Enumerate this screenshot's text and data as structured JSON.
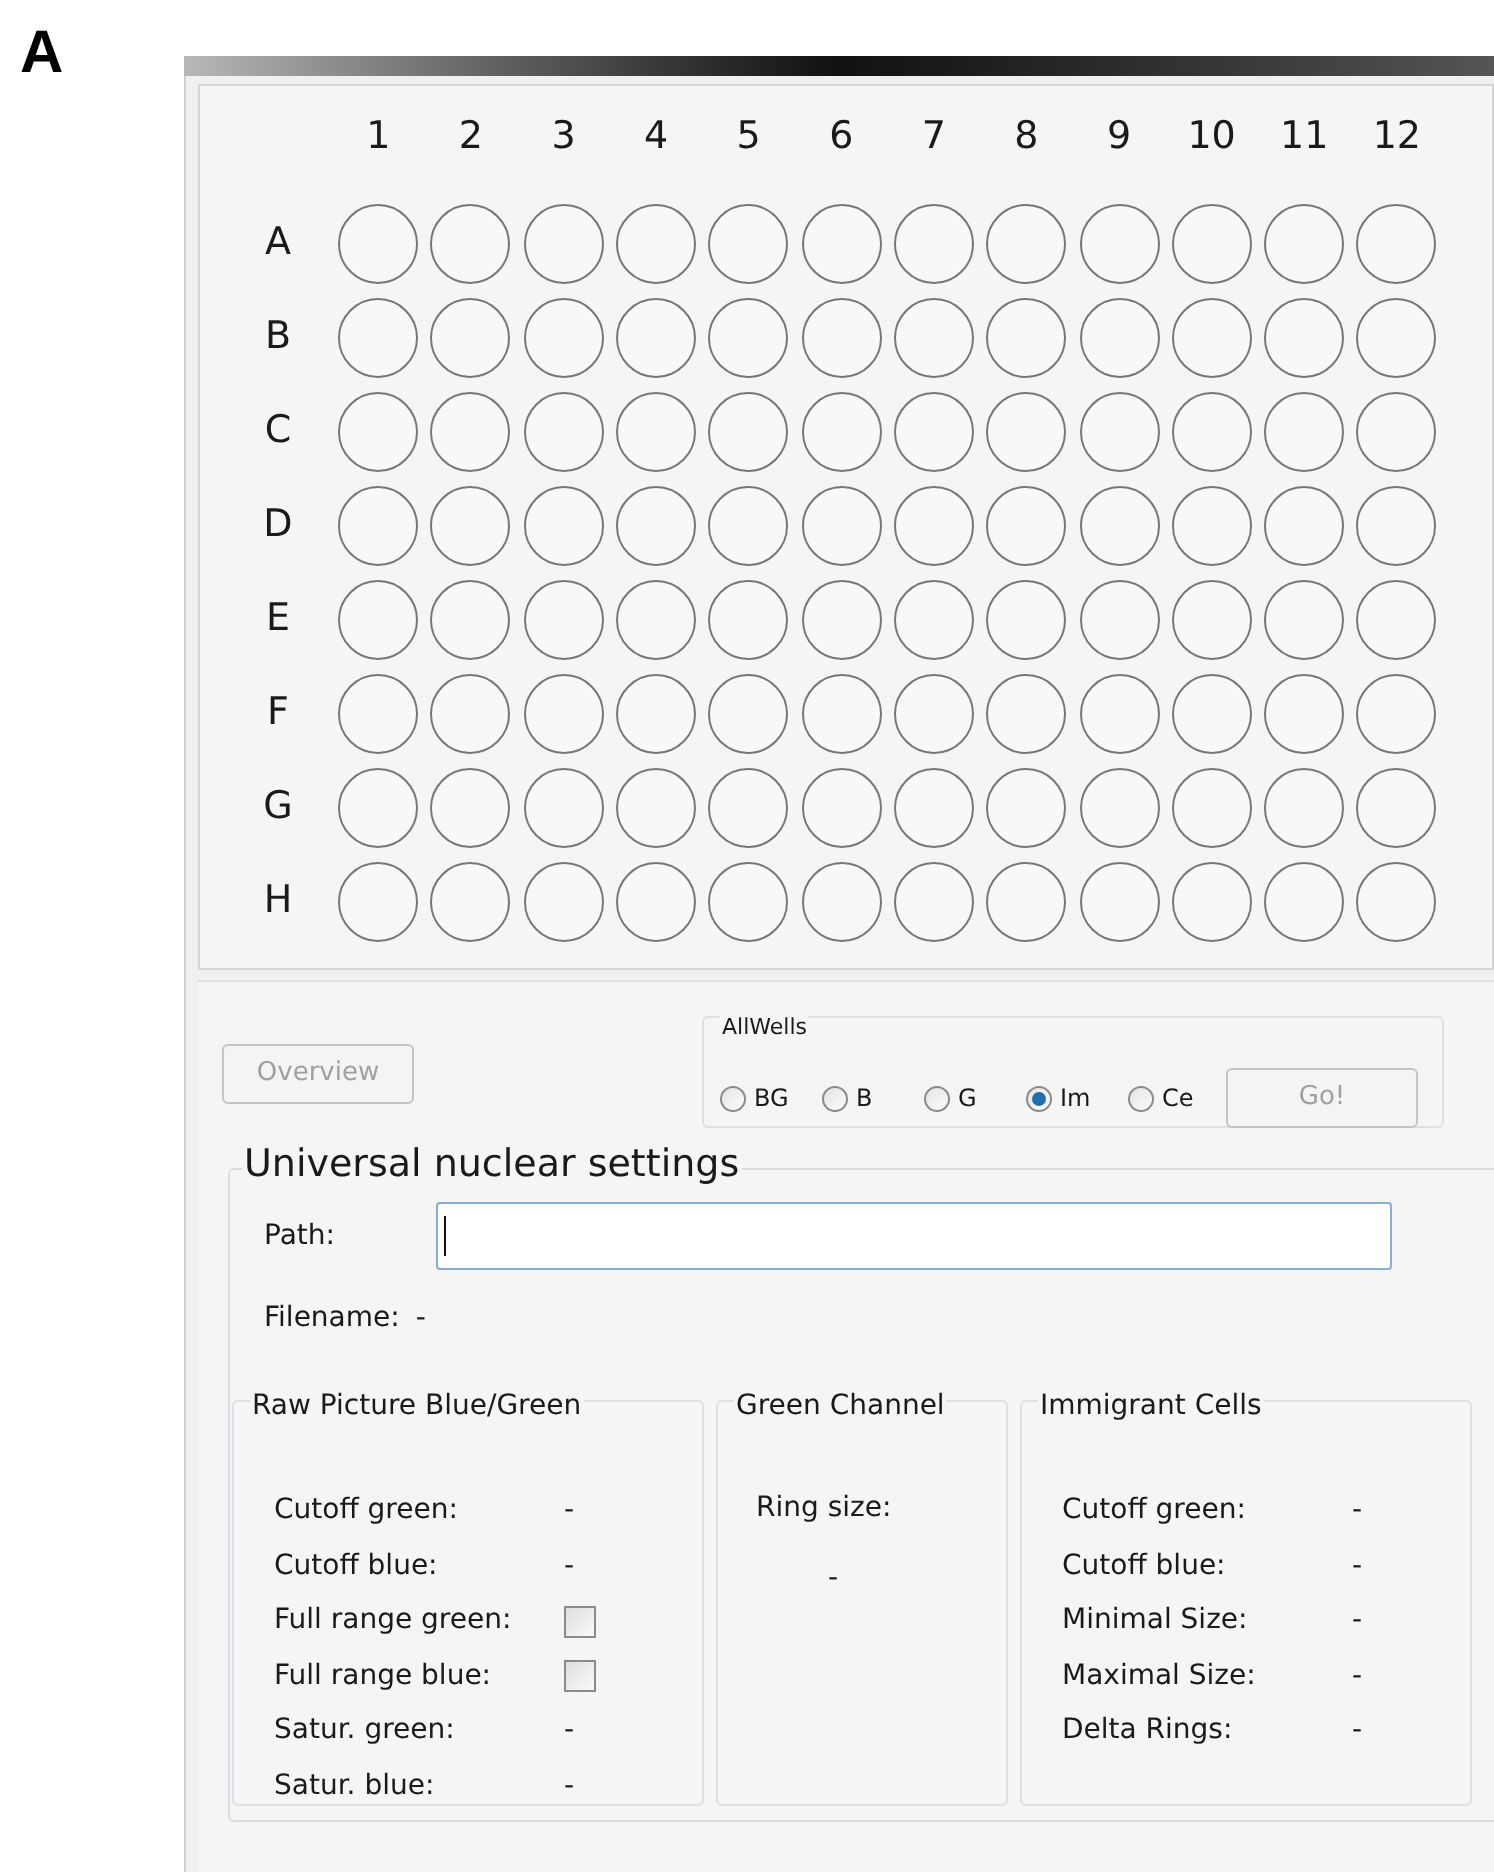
{
  "panel_label": "A",
  "plate": {
    "columns": [
      "1",
      "2",
      "3",
      "4",
      "5",
      "6",
      "7",
      "8",
      "9",
      "10",
      "11",
      "12"
    ],
    "rows": [
      "A",
      "B",
      "C",
      "D",
      "E",
      "F",
      "G",
      "H"
    ]
  },
  "overview_button": {
    "label": "Overview",
    "disabled": true
  },
  "all_wells": {
    "title": "AllWells",
    "options": [
      {
        "label": "BG",
        "selected": false
      },
      {
        "label": "B",
        "selected": false
      },
      {
        "label": "G",
        "selected": false
      },
      {
        "label": "Im",
        "selected": true
      },
      {
        "label": "Ce",
        "selected": false
      }
    ],
    "go_button": {
      "label": "Go!",
      "disabled": true
    }
  },
  "settings": {
    "title": "Universal nuclear settings",
    "path_label": "Path:",
    "filename_label": "Filename:",
    "filename_value": "-",
    "groups": [
      {
        "title": "Raw Picture Blue/Green",
        "items": [
          {
            "kind": "value",
            "label": "Cutoff green:",
            "value": "-"
          },
          {
            "kind": "value",
            "label": "Cutoff blue:",
            "value": "-"
          },
          {
            "kind": "checkbox",
            "label": "Full range green:",
            "checked": false
          },
          {
            "kind": "checkbox",
            "label": "Full range blue:",
            "checked": false
          },
          {
            "kind": "value",
            "label": "Satur. green:",
            "value": "-"
          },
          {
            "kind": "value",
            "label": "Satur. blue:",
            "value": "-"
          }
        ]
      },
      {
        "title": "Green Channel",
        "items": [
          {
            "kind": "stacked_value",
            "label": "Ring size:",
            "value": "-"
          }
        ]
      },
      {
        "title": "Immigrant Cells",
        "items": [
          {
            "kind": "value",
            "label": "Cutoff green:",
            "value": "-"
          },
          {
            "kind": "value",
            "label": "Cutoff blue:",
            "value": "-"
          },
          {
            "kind": "value",
            "label": "Minimal Size:",
            "value": "-"
          },
          {
            "kind": "value",
            "label": "Maximal Size:",
            "value": "-"
          },
          {
            "kind": "value",
            "label": "Delta Rings:",
            "value": "-"
          }
        ]
      }
    ]
  }
}
